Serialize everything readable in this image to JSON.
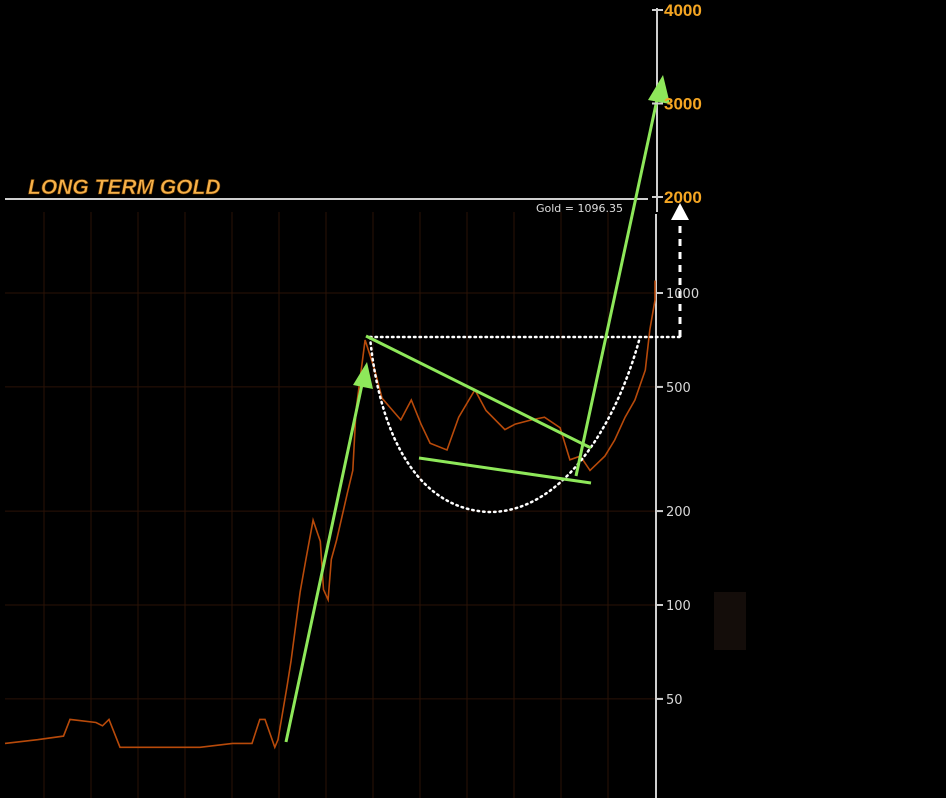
{
  "chart_data": {
    "type": "line",
    "title": "LONG TERM GOLD",
    "readout": "Gold = 1096.35",
    "xlabel": "",
    "ylabel": "",
    "yscale": "log",
    "ylim": [
      30,
      4000
    ],
    "grid": true,
    "y_ticks_small": [
      "50",
      "100",
      "200",
      "500",
      "1000"
    ],
    "y_ticks_small_values": [
      50,
      100,
      200,
      500,
      1000
    ],
    "y_ticks_big": [
      "2000",
      "3000",
      "4000"
    ],
    "y_ticks_big_values": [
      2000,
      3000,
      4000
    ],
    "series": [
      {
        "name": "Gold",
        "color": "#b84a0a",
        "x": [
          0,
          5,
          9,
          10,
          14,
          15,
          16,
          17.7,
          20,
          25,
          30,
          35,
          38,
          39.2,
          40,
          41.5,
          42,
          43.4,
          44,
          45.4,
          46.3,
          47.4,
          48.5,
          49,
          49.7,
          50.2,
          51,
          52.7,
          53.5,
          54,
          55.4,
          56.9,
          58,
          60.9,
          62.5,
          64,
          65.4,
          68,
          69.8,
          72.3,
          74,
          76.9,
          78.5,
          81,
          83,
          85.4,
          86.9,
          88.5,
          90,
          92.3,
          93.8,
          95.4,
          96.9,
          98.5,
          99.2,
          100
        ],
        "values": [
          36,
          37,
          38,
          43,
          42,
          41,
          43,
          35,
          35,
          35,
          35,
          36,
          36,
          43,
          43,
          35,
          37,
          55,
          66,
          110,
          140,
          187,
          160,
          112,
          104,
          140,
          161,
          230,
          270,
          420,
          707,
          566,
          460,
          392,
          454,
          380,
          330,
          314,
          400,
          489,
          420,
          365,
          380,
          392,
          400,
          370,
          292,
          300,
          270,
          300,
          338,
          400,
          454,
          566,
          761,
          950
        ],
        "last_value": 1096.35
      }
    ],
    "annotations": {
      "accent_color": "#8ee85a",
      "pattern": "cup-and-handle",
      "dotted_color": "#ffffff"
    }
  }
}
